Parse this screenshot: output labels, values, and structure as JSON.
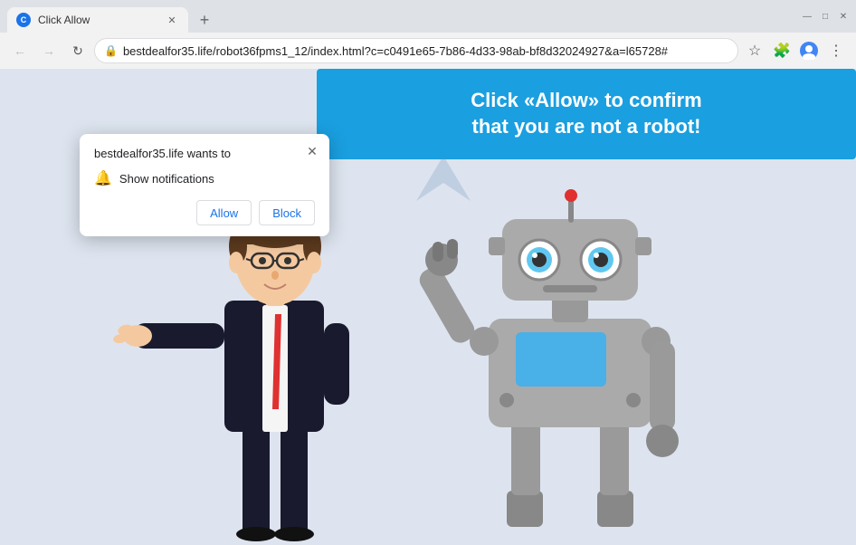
{
  "browser": {
    "tab_title": "Click Allow",
    "tab_favicon": "C",
    "close_symbol": "✕",
    "new_tab_symbol": "+",
    "nav": {
      "back": "←",
      "forward": "→",
      "reload": "↻"
    },
    "address": "bestdealfor35.life/robot36fpms1_12/index.html?c=c0491e65-7b86-4d33-98ab-bf8d32024927&a=l65728#",
    "lock_icon": "🔒",
    "window_controls": {
      "minimize": "—",
      "maximize": "□",
      "close": "✕"
    }
  },
  "popup": {
    "title": "bestdealfor35.life wants to",
    "close_symbol": "✕",
    "notification_label": "Show notifications",
    "allow_label": "Allow",
    "block_label": "Block"
  },
  "page": {
    "banner_line1": "Click «Allow» to confirm",
    "banner_line2": "that you are not a robot!"
  },
  "colors": {
    "tab_bg": "#f2f2f2",
    "address_bar_bg": "#f2f2f2",
    "page_bg": "#dde4ef",
    "banner_bg": "#1a9fe0",
    "popup_bg": "#ffffff",
    "allow_btn_color": "#1a73e8",
    "block_btn_color": "#1a73e8"
  }
}
